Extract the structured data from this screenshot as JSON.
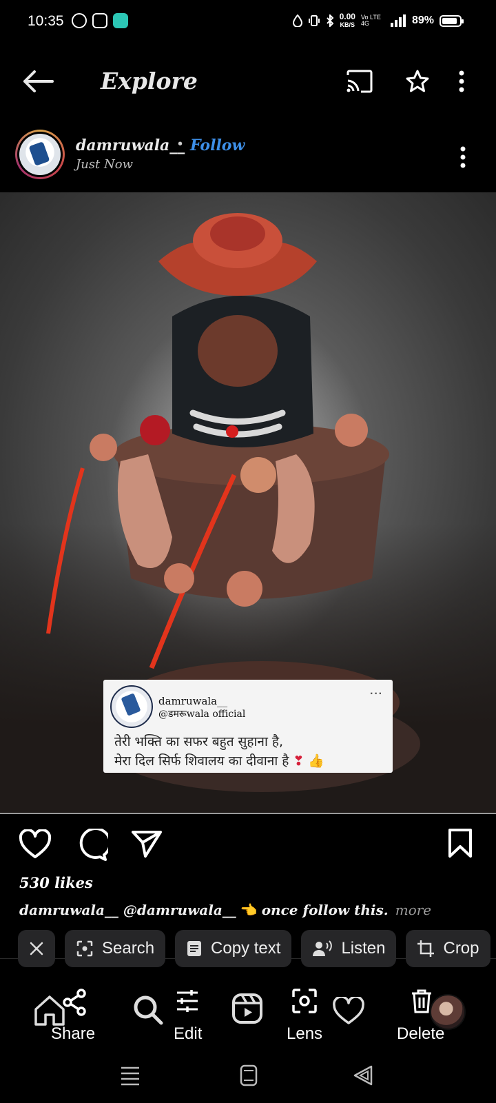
{
  "status_bar": {
    "time": "10:35",
    "speed_value": "0.00",
    "speed_unit": "KB/S",
    "network": "Vo LTE 4G",
    "battery": "89%",
    "battery_level": 0.89
  },
  "app_bar": {
    "title": "Explore",
    "icons": [
      "back-arrow-icon",
      "cast-icon",
      "star-icon",
      "more-vert-icon"
    ]
  },
  "post": {
    "username": "damruwala__",
    "separator": "•",
    "follow_label": "Follow",
    "time": "Just Now",
    "likes": "530 likes",
    "caption_user": "damruwala__",
    "caption_text": "@damruwala__",
    "caption_emoji": "👈",
    "caption_tail": "once follow this.",
    "more_label": "more"
  },
  "quote_card": {
    "name": "damruwala__",
    "handle": "@डमरूwala official",
    "dots": "···",
    "line1": "तेरी भक्ति का सफर बहुत सुहाना है,",
    "line2": "मेरा दिल सिर्फ शिवालय का दीवाना है",
    "emoji_heart": "❣",
    "emoji_thumb": "👍"
  },
  "lens_chips": {
    "close_icon": "close-icon",
    "search": "Search",
    "copy_text": "Copy text",
    "listen": "Listen",
    "crop": "Crop"
  },
  "toolbar": {
    "share": "Share",
    "edit": "Edit",
    "lens": "Lens",
    "delete": "Delete"
  },
  "colors": {
    "follow": "#3d8fe8",
    "chip_bg": "#262628",
    "background": "#000000"
  }
}
